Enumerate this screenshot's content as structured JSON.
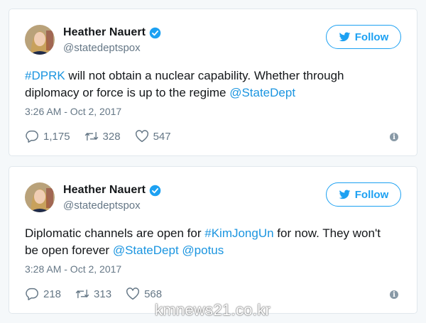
{
  "tweets": [
    {
      "author": {
        "name": "Heather Nauert",
        "handle": "@statedeptspox"
      },
      "follow_label": "Follow",
      "text_parts": [
        {
          "text": "#DPRK",
          "link": true
        },
        {
          "text": " will not obtain a nuclear capability. Whether through diplomacy or force is up to the regime ",
          "link": false
        },
        {
          "text": "@StateDept",
          "link": true
        }
      ],
      "timestamp": "3:26 AM - Oct 2, 2017",
      "stats": {
        "replies": "1,175",
        "retweets": "328",
        "likes": "547"
      }
    },
    {
      "author": {
        "name": "Heather Nauert",
        "handle": "@statedeptspox"
      },
      "follow_label": "Follow",
      "text_parts": [
        {
          "text": "Diplomatic channels are open for ",
          "link": false
        },
        {
          "text": "#KimJongUn",
          "link": true
        },
        {
          "text": " for now. They won't be open forever ",
          "link": false
        },
        {
          "text": "@StateDept",
          "link": true
        },
        {
          "text": " ",
          "link": false
        },
        {
          "text": "@potus",
          "link": true
        }
      ],
      "timestamp": "3:28 AM - Oct 2, 2017",
      "stats": {
        "replies": "218",
        "retweets": "313",
        "likes": "568"
      }
    }
  ],
  "watermark": "kmnews21.co.kr",
  "icons": {
    "reply": "reply-icon",
    "retweet": "retweet-icon",
    "like": "heart-icon",
    "follow": "twitter-bird-icon",
    "verified": "verified-badge-icon",
    "info": "info-icon"
  },
  "colors": {
    "link": "#1b95e0",
    "brand": "#1da1f2",
    "muted": "#657786"
  }
}
